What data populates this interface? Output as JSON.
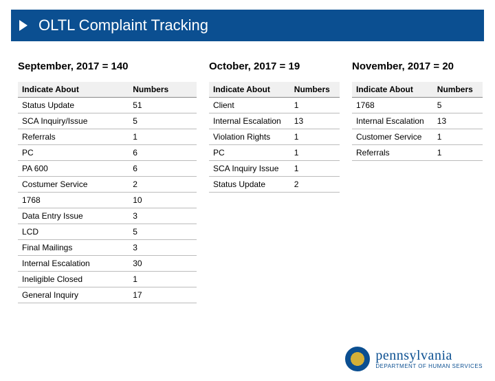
{
  "title": "OLTL Complaint Tracking",
  "logo": {
    "state": "pennsylvania",
    "dept": "DEPARTMENT OF HUMAN SERVICES"
  },
  "months": {
    "sep": {
      "label": "September, 2017 = 140",
      "header_about": "Indicate About",
      "header_num": "Numbers",
      "rows": [
        {
          "a": "Status Update",
          "n": "51"
        },
        {
          "a": "SCA Inquiry/Issue",
          "n": "5"
        },
        {
          "a": "Referrals",
          "n": "1"
        },
        {
          "a": "PC",
          "n": "6"
        },
        {
          "a": "PA 600",
          "n": "6"
        },
        {
          "a": "Costumer Service",
          "n": "2"
        },
        {
          "a": "1768",
          "n": "10"
        },
        {
          "a": "Data Entry Issue",
          "n": "3"
        },
        {
          "a": "LCD",
          "n": "5"
        },
        {
          "a": "Final Mailings",
          "n": "3"
        },
        {
          "a": "Internal Escalation",
          "n": "30"
        },
        {
          "a": "Ineligible Closed",
          "n": "1"
        },
        {
          "a": "General Inquiry",
          "n": "17"
        }
      ]
    },
    "oct": {
      "label": "October, 2017 = 19",
      "header_about": "Indicate About",
      "header_num": "Numbers",
      "rows": [
        {
          "a": "Client",
          "n": "1"
        },
        {
          "a": "Internal Escalation",
          "n": "13"
        },
        {
          "a": "Violation Rights",
          "n": "1"
        },
        {
          "a": "PC",
          "n": "1"
        },
        {
          "a": "SCA Inquiry Issue",
          "n": "1"
        },
        {
          "a": "Status Update",
          "n": "2"
        }
      ]
    },
    "nov": {
      "label": "November, 2017 = 20",
      "header_about": "Indicate About",
      "header_num": "Numbers",
      "rows": [
        {
          "a": "1768",
          "n": "5"
        },
        {
          "a": "Internal Escalation",
          "n": "13"
        },
        {
          "a": "Customer Service",
          "n": "1"
        },
        {
          "a": "Referrals",
          "n": "1"
        }
      ]
    }
  }
}
